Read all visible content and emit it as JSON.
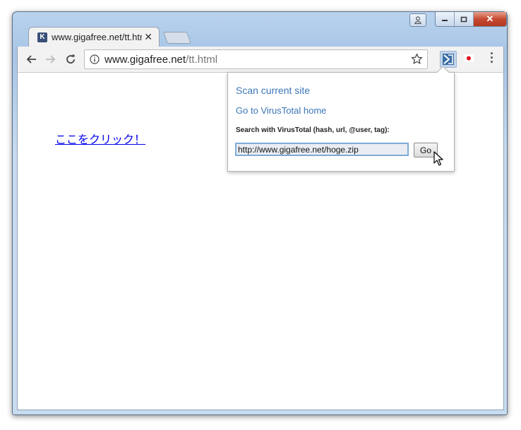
{
  "window": {
    "caption_close": "✕"
  },
  "tabs": [
    {
      "title": "www.gigafree.net/tt.html",
      "favicon": "K",
      "close": "✕"
    }
  ],
  "toolbar": {
    "url_domain": "www.gigafree.net",
    "url_path": "/tt.html",
    "icons": [
      "back-icon",
      "forward-icon",
      "reload-icon",
      "info-icon",
      "star-icon",
      "virustotal-extension-icon",
      "japan-flag-icon",
      "menu-icon"
    ]
  },
  "page": {
    "link_text": "ここをクリック！"
  },
  "popup": {
    "scan_label": "Scan current site",
    "home_label": "Go to VirusTotal home",
    "search_label": "Search with VirusTotal (hash, url, @user, tag):",
    "search_value": "http://www.gigafree.net/hoge.zip",
    "go_label": "Go"
  }
}
